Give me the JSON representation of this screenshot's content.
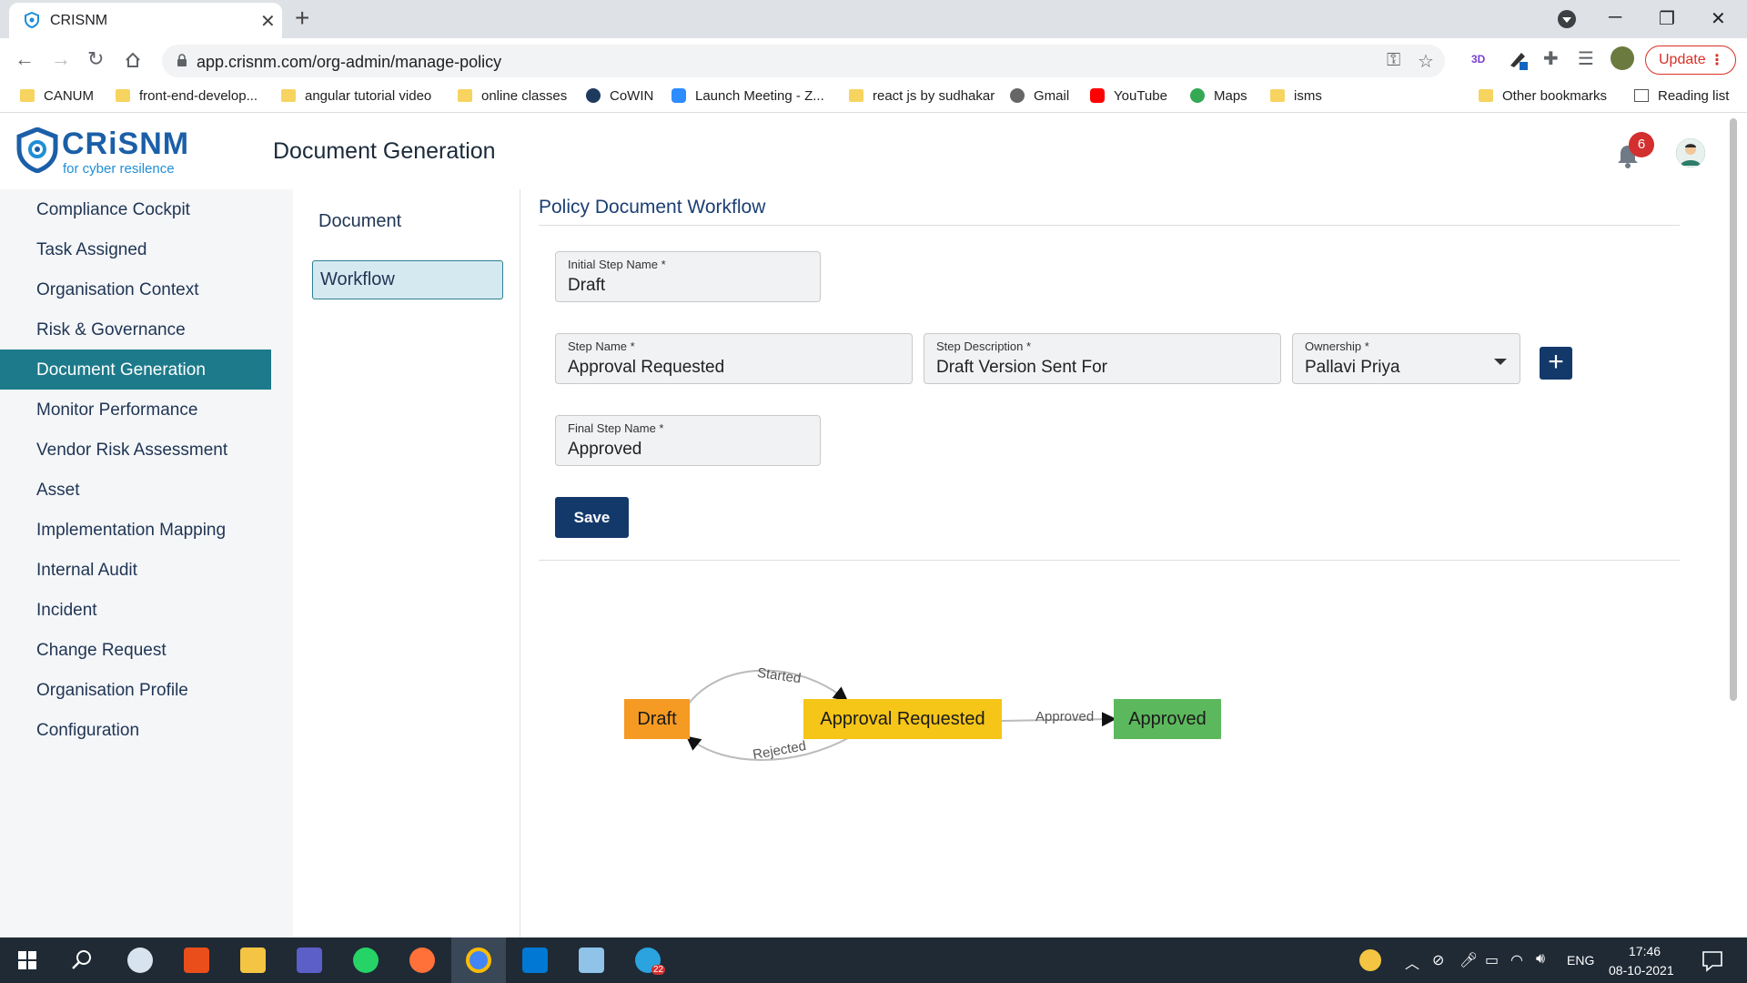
{
  "browser": {
    "tab_title": "CRISNM",
    "url": "app.crisnm.com/org-admin/manage-policy",
    "update_label": "Update",
    "bookmarks": [
      "CANUM",
      "front-end-develop...",
      "angular tutorial video",
      "online classes",
      "CoWIN",
      "Launch Meeting - Z...",
      "react js by sudhakar",
      "Gmail",
      "YouTube",
      "Maps",
      "isms"
    ],
    "other_bookmarks": "Other bookmarks",
    "reading_list": "Reading list"
  },
  "header": {
    "logo_text": "CRiSNM",
    "logo_tagline": "for cyber resilence",
    "page_title": "Document Generation",
    "notification_count": "6"
  },
  "sidebar": {
    "items": [
      {
        "label": "Compliance Cockpit"
      },
      {
        "label": "Task Assigned"
      },
      {
        "label": "Organisation Context"
      },
      {
        "label": "Risk & Governance"
      },
      {
        "label": "Document Generation"
      },
      {
        "label": "Monitor Performance"
      },
      {
        "label": "Vendor Risk Assessment"
      },
      {
        "label": "Asset"
      },
      {
        "label": "Implementation Mapping"
      },
      {
        "label": "Internal Audit"
      },
      {
        "label": "Incident"
      },
      {
        "label": "Change Request"
      },
      {
        "label": "Organisation Profile"
      },
      {
        "label": "Configuration"
      }
    ],
    "active_index": 4
  },
  "subnav": {
    "document_label": "Document",
    "workflow_label": "Workflow"
  },
  "workflow": {
    "title": "Policy Document Workflow",
    "initial_step": {
      "label": "Initial Step Name *",
      "value": "Draft"
    },
    "step_name": {
      "label": "Step Name *",
      "value": "Approval Requested"
    },
    "step_description": {
      "label": "Step Description *",
      "value": "Draft Version Sent For"
    },
    "ownership": {
      "label": "Ownership *",
      "value": "Pallavi Priya"
    },
    "final_step": {
      "label": "Final Step Name *",
      "value": "Approved"
    },
    "add_label": "+",
    "save_label": "Save"
  },
  "graph": {
    "nodes": [
      {
        "label": "Draft",
        "color": "#f59a23"
      },
      {
        "label": "Approval Requested",
        "color": "#f5c518"
      },
      {
        "label": "Approved",
        "color": "#5cb85c"
      }
    ],
    "edges": [
      {
        "label": "Started"
      },
      {
        "label": "Rejected"
      },
      {
        "label": "Approved"
      }
    ]
  },
  "taskbar": {
    "language": "ENG",
    "time": "17:46",
    "date": "08-10-2021",
    "telegram_badge": "22"
  },
  "colors": {
    "brand_blue": "#1b5fa8",
    "sidebar_active": "#1d7a8a",
    "primary_button": "#13396b",
    "badge_red": "#d32f2f"
  }
}
